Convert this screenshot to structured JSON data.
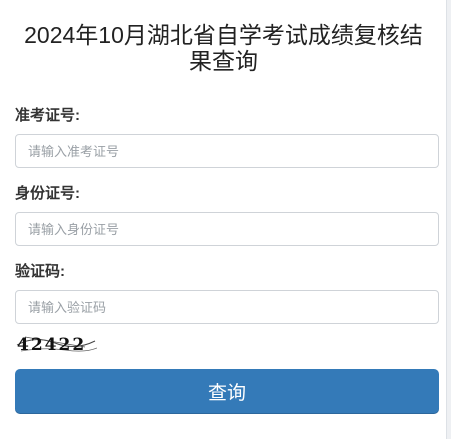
{
  "page": {
    "title": "2024年10月湖北省自学考试成绩复核结果查询"
  },
  "form": {
    "admission": {
      "label": "准考证号:",
      "placeholder": "请输入准考证号"
    },
    "id_number": {
      "label": "身份证号:",
      "placeholder": "请输入身份证号"
    },
    "captcha": {
      "label": "验证码:",
      "placeholder": "请输入验证码",
      "image_text": "42422"
    },
    "submit_label": "查询"
  },
  "colors": {
    "primary_button": "#347ab8",
    "page_background": "#eef0f3"
  }
}
